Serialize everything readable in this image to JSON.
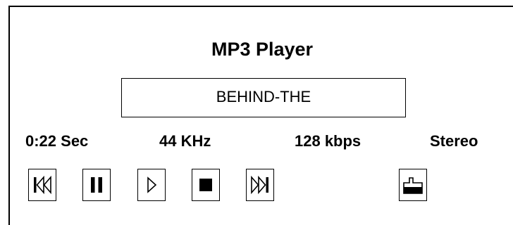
{
  "player": {
    "title": "MP3 Player",
    "track": "BEHIND-THE"
  },
  "status": {
    "time": "0:22 Sec",
    "sample_rate": "44 KHz",
    "bitrate": "128 kbps",
    "mode": "Stereo"
  },
  "controls": [
    {
      "name": "previous",
      "icon": "skip-back-icon"
    },
    {
      "name": "pause",
      "icon": "pause-icon"
    },
    {
      "name": "play",
      "icon": "play-icon"
    },
    {
      "name": "stop",
      "icon": "stop-icon"
    },
    {
      "name": "next",
      "icon": "skip-forward-icon"
    },
    {
      "name": "open",
      "icon": "folder-icon"
    }
  ],
  "colors": {
    "foreground": "#000000",
    "background": "#ffffff"
  }
}
